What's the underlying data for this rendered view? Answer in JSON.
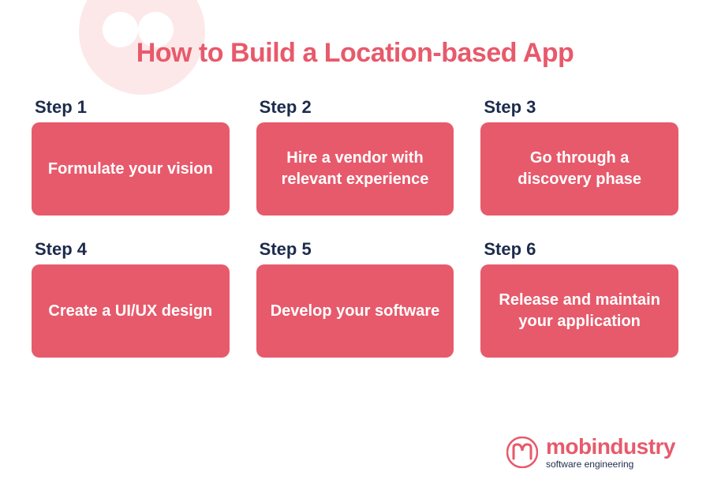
{
  "title": "How to Build a Location-based App",
  "steps": [
    {
      "label": "Step 1",
      "content": "Formulate your vision"
    },
    {
      "label": "Step 2",
      "content": "Hire a vendor with relevant experience"
    },
    {
      "label": "Step 3",
      "content": "Go through a discovery phase"
    },
    {
      "label": "Step 4",
      "content": "Create a UI/UX design"
    },
    {
      "label": "Step 5",
      "content": "Develop your software"
    },
    {
      "label": "Step 6",
      "content": "Release and maintain your application"
    }
  ],
  "brand": {
    "name": "mobindustry",
    "tagline": "software engineering"
  },
  "colors": {
    "accent": "#e75a6b",
    "dark": "#1d2b4c",
    "decoration": "#fde8e9"
  }
}
